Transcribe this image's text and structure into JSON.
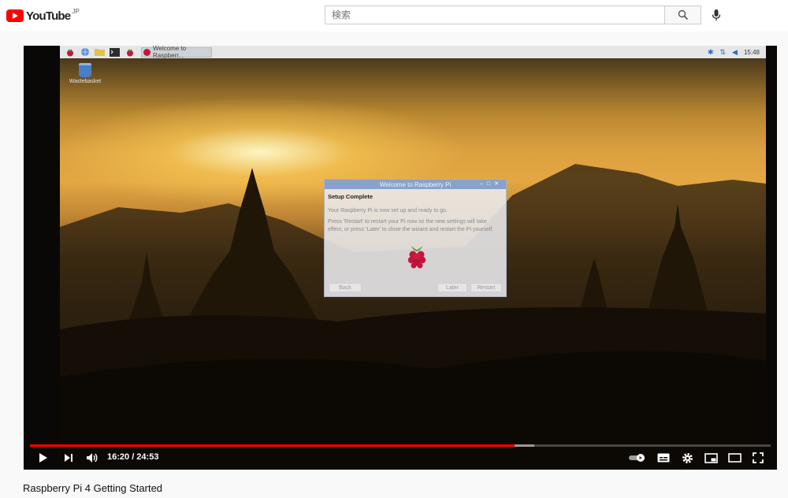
{
  "header": {
    "logo_text": "YouTube",
    "logo_region": "JP",
    "search_placeholder": "検索",
    "accent": "#ff0000"
  },
  "desktop": {
    "taskbar_window_label": "Welcome to Raspberr...",
    "clock": "15:48",
    "wastebasket_label": "Wastebasket"
  },
  "dialog": {
    "title": "Welcome to Raspberry Pi",
    "controls": "–□✕",
    "heading": "Setup Complete",
    "line1": "Your Raspberry Pi is now set up and ready to go.",
    "line2": "Press 'Restart' to restart your Pi now so the new settings will take effect, or press 'Later' to close the wizard and restart the Pi yourself.",
    "back_label": "Back",
    "later_label": "Later",
    "restart_label": "Restart"
  },
  "player": {
    "time_display": "16:20 / 24:53",
    "progress_played": 0.654,
    "progress_buffered": 0.681
  },
  "video_title": "Raspberry Pi 4 Getting Started"
}
